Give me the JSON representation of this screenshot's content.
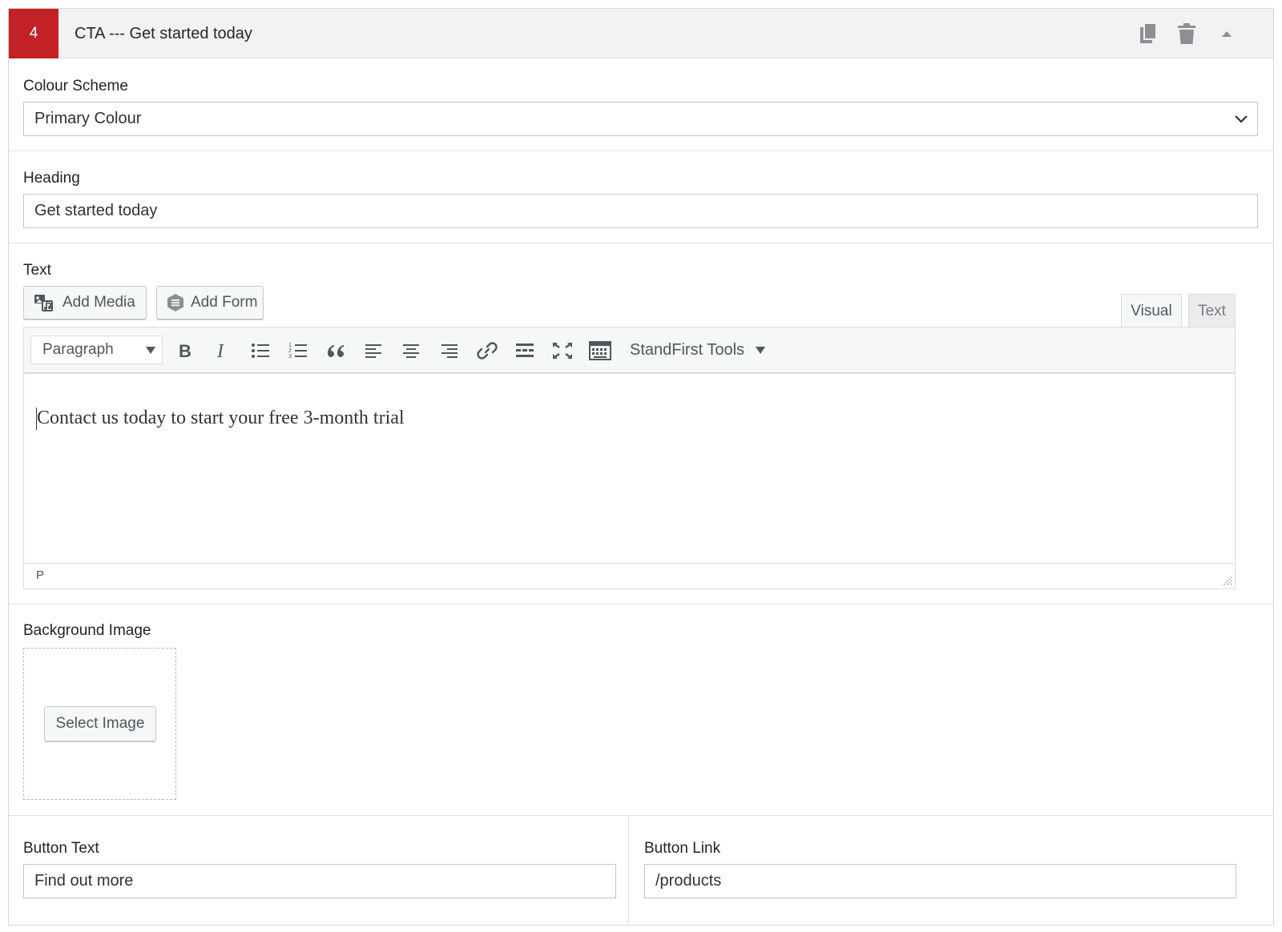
{
  "layout": {
    "order": "4",
    "title": "CTA --- Get started today"
  },
  "fields": {
    "colour_scheme": {
      "label": "Colour Scheme",
      "value": "Primary Colour"
    },
    "heading": {
      "label": "Heading",
      "value": "Get started today"
    },
    "text": {
      "label": "Text",
      "add_media": "Add Media",
      "add_form": "Add Form",
      "tab_visual": "Visual",
      "tab_text": "Text",
      "format_select": "Paragraph",
      "toolbar_menu": "StandFirst Tools",
      "content": "Contact us today to start your free 3-month trial",
      "status_path": "P"
    },
    "background_image": {
      "label": "Background Image",
      "button": "Select Image"
    },
    "button_text": {
      "label": "Button Text",
      "value": "Find out more"
    },
    "button_link": {
      "label": "Button Link",
      "value": "/products"
    }
  },
  "colors": {
    "order_badge": "#c42127",
    "header_bg": "#f2f2f2",
    "border": "#c3c4c7"
  }
}
